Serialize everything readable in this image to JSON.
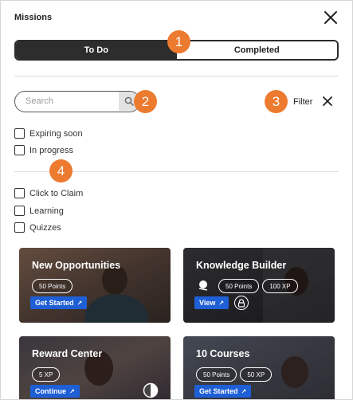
{
  "header": {
    "title": "Missions"
  },
  "tabs": [
    {
      "label": "To Do",
      "active": true
    },
    {
      "label": "Completed",
      "active": false
    }
  ],
  "search": {
    "placeholder": "Search",
    "value": ""
  },
  "filter": {
    "label": "Filter"
  },
  "status_filters": [
    {
      "label": "Expiring soon",
      "checked": false
    },
    {
      "label": "In progress",
      "checked": false
    }
  ],
  "type_filters": [
    {
      "label": "Click to Claim",
      "checked": false
    },
    {
      "label": "Learning",
      "checked": false
    },
    {
      "label": "Quizzes",
      "checked": false
    }
  ],
  "callouts": [
    "1",
    "2",
    "3",
    "4"
  ],
  "cards": [
    {
      "title": "New Opportunities",
      "pills": [
        "50 Points"
      ],
      "button": "Get Started",
      "arrow": "↗"
    },
    {
      "title": "Knowledge Builder",
      "pills": [
        "50 Points",
        "100 XP"
      ],
      "button": "View",
      "arrow": "↗",
      "locked": true
    },
    {
      "title": "Reward Center",
      "pills": [
        "5 XP"
      ],
      "button": "Continue",
      "arrow": "↗",
      "progress": 0.5
    },
    {
      "title": "10 Courses",
      "pills": [
        "50 Points",
        "50 XP"
      ],
      "button": "Get Started",
      "arrow": "↗"
    }
  ],
  "colors": {
    "accent_button": "#1f5fd6",
    "callout": "#ec7a2f",
    "tab_active": "#2d2d2d"
  }
}
